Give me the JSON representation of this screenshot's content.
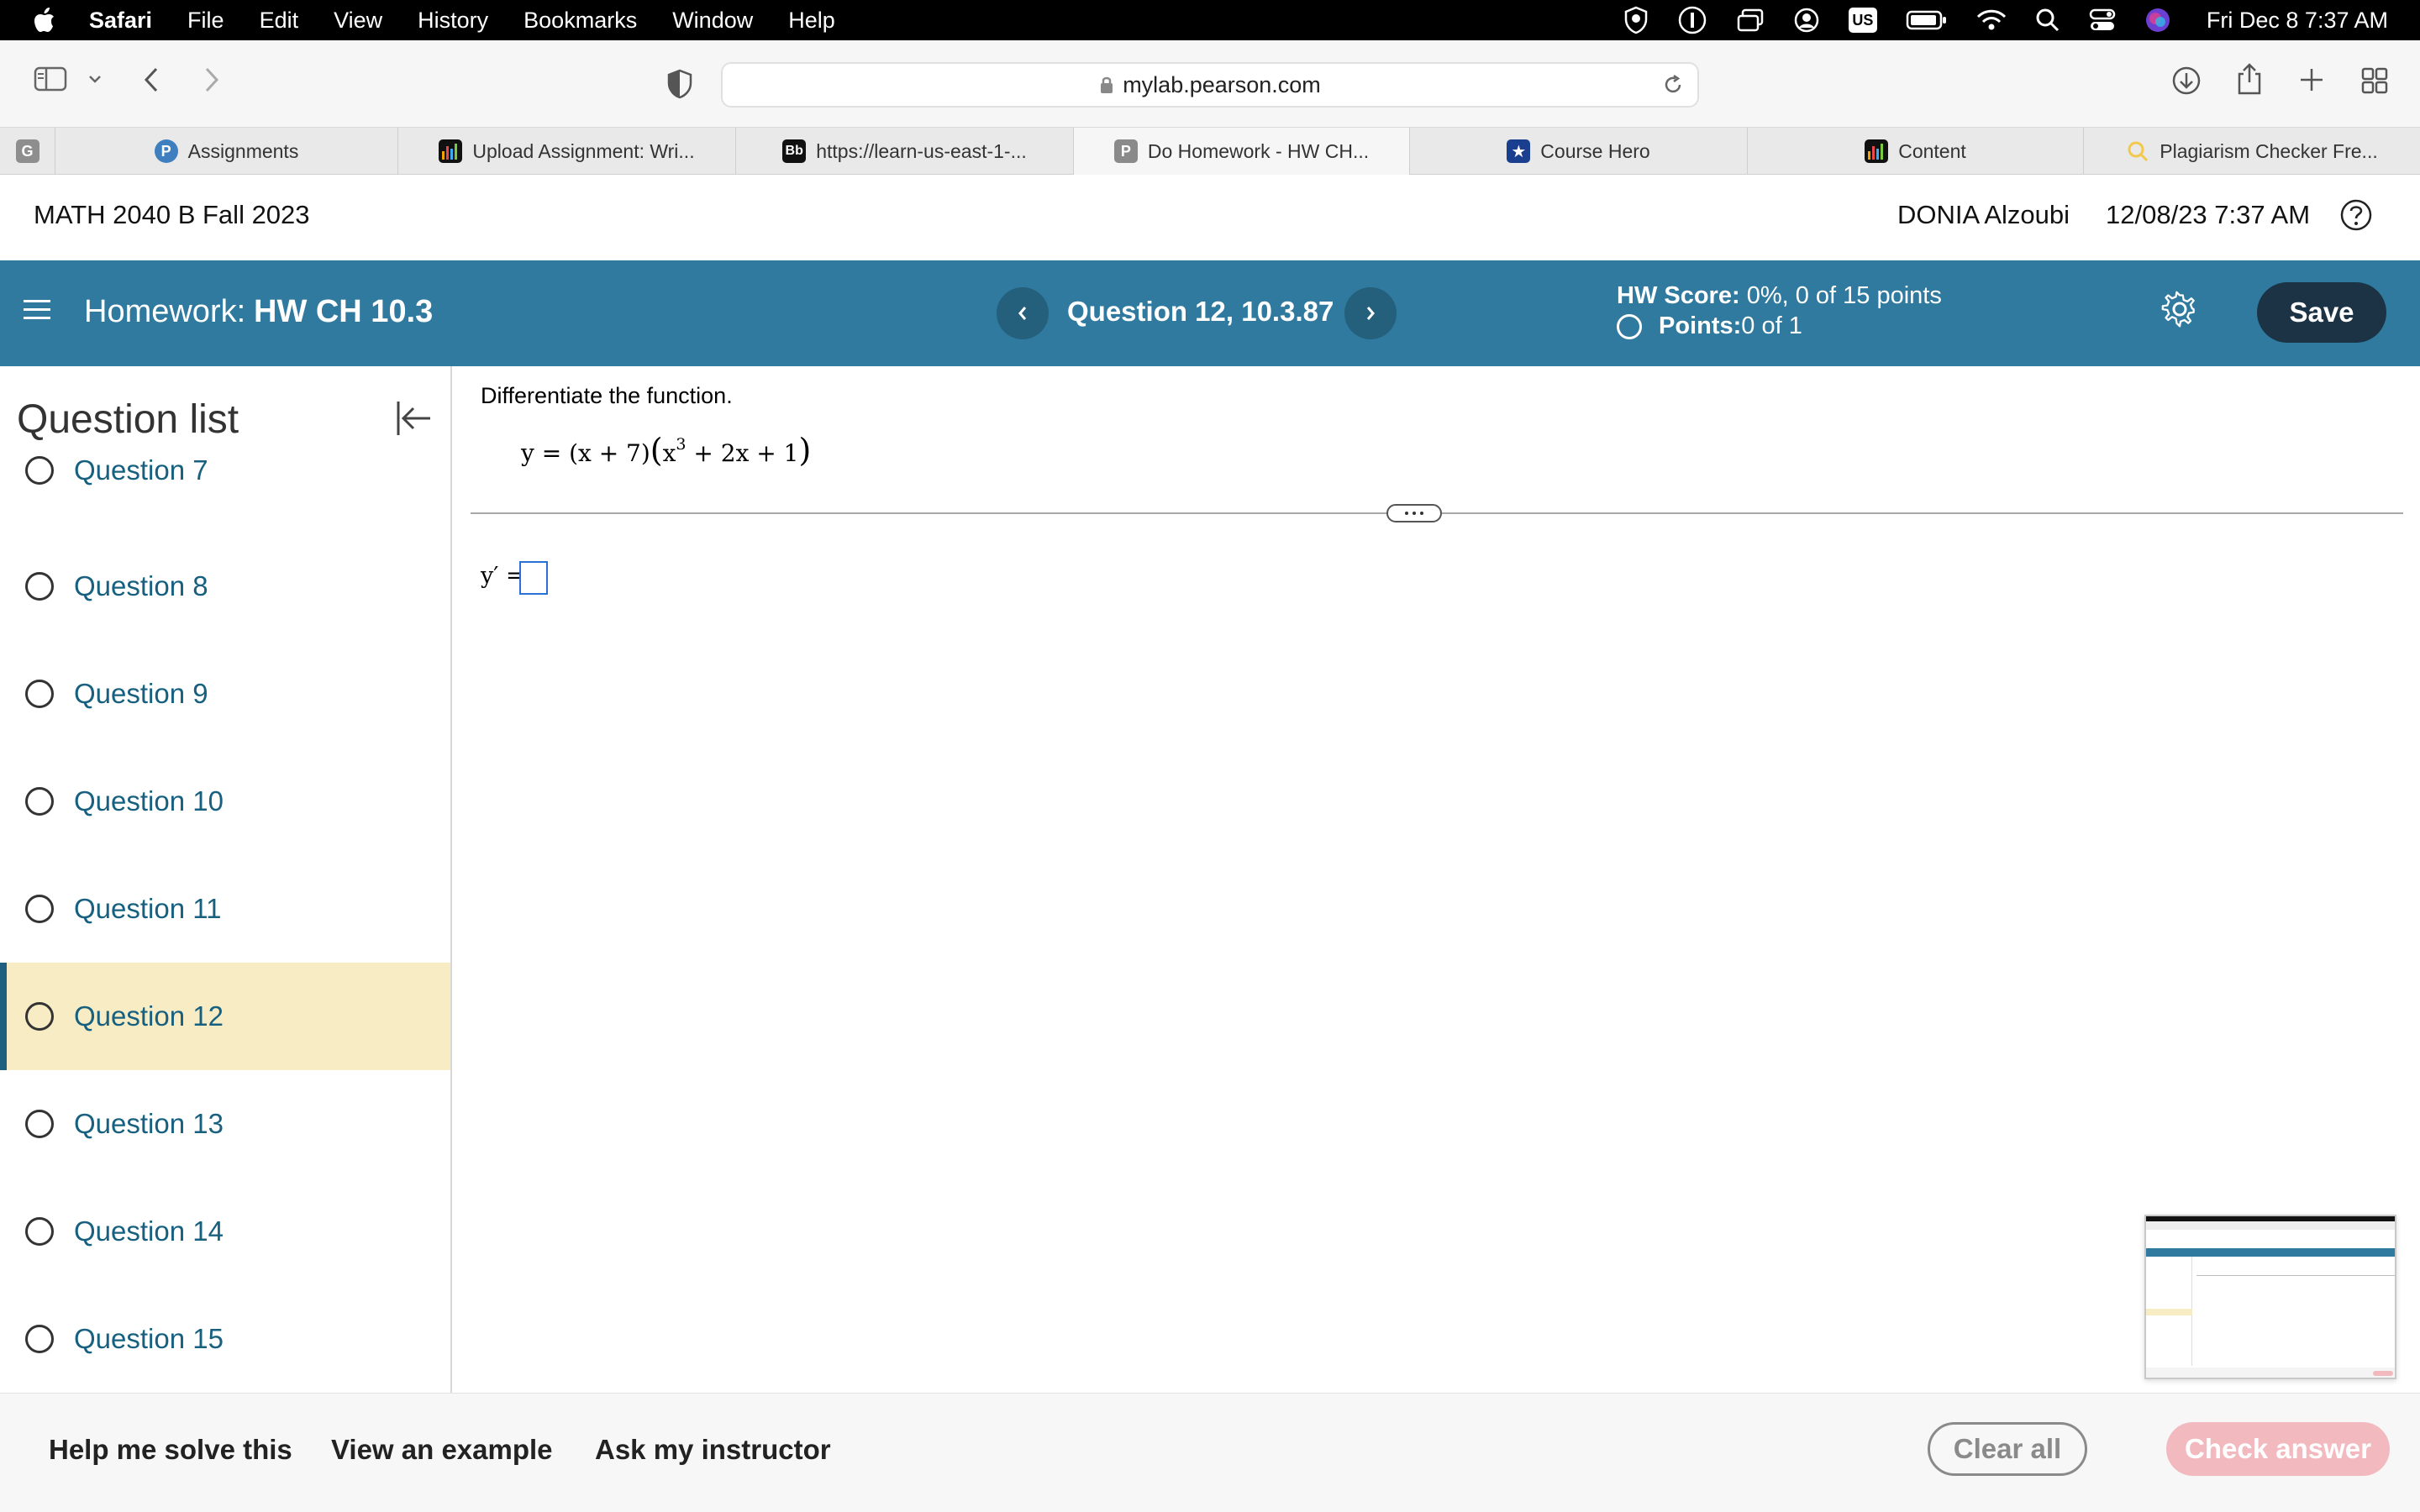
{
  "menubar": {
    "app": "Safari",
    "items": [
      "File",
      "Edit",
      "View",
      "History",
      "Bookmarks",
      "Window",
      "Help"
    ],
    "clock": "Fri Dec 8  7:37 AM",
    "input_source": "US"
  },
  "browser": {
    "url": "mylab.pearson.com",
    "tabs": [
      {
        "label": "",
        "fav_text": "G",
        "fav_color": "#8e8e8e"
      },
      {
        "label": "Assignments",
        "fav_text": "P",
        "fav_color": "#3f7fbf"
      },
      {
        "label": "Upload Assignment: Wri...",
        "fav_text": "",
        "fav_color": "#f0a500"
      },
      {
        "label": "https://learn-us-east-1-...",
        "fav_text": "Bb",
        "fav_color": "#111111"
      },
      {
        "label": "Do Homework - HW CH...",
        "fav_text": "P",
        "fav_color": "#8a8a8a"
      },
      {
        "label": "Course Hero",
        "fav_text": "★",
        "fav_color": "#1a3f8f"
      },
      {
        "label": "Content",
        "fav_text": "",
        "fav_color": "#f0a500"
      },
      {
        "label": "Plagiarism Checker Fre...",
        "fav_text": "",
        "fav_color": "#f2c94c"
      }
    ]
  },
  "course": {
    "title": "MATH 2040 B Fall 2023",
    "user": "DONIA Alzoubi",
    "datetime": "12/08/23 7:37 AM"
  },
  "homework": {
    "label": "Homework:",
    "name": "HW CH 10.3",
    "question_title": "Question 12, 10.3.87",
    "score_label": "HW Score:",
    "score_value": " 0%, 0 of 15 points",
    "points_label": "Points:",
    "points_value": " 0 of 1",
    "save_label": "Save"
  },
  "sidebar": {
    "title": "Question list",
    "items": [
      {
        "label": "Question 7",
        "current": false
      },
      {
        "label": "Question 8",
        "current": false
      },
      {
        "label": "Question 9",
        "current": false
      },
      {
        "label": "Question 10",
        "current": false
      },
      {
        "label": "Question 11",
        "current": false
      },
      {
        "label": "Question 12",
        "current": true
      },
      {
        "label": "Question 13",
        "current": false
      },
      {
        "label": "Question 14",
        "current": false
      },
      {
        "label": "Question 15",
        "current": false
      }
    ]
  },
  "question": {
    "instruction": "Differentiate the function.",
    "equation": {
      "lhs": "y = (x + 7)",
      "open_paren": "(",
      "base": "x",
      "exponent": "3",
      "rest": " + 2x + 1",
      "close_paren": ")"
    },
    "answer_label": "y′ ="
  },
  "footer": {
    "help_label": "Help me solve this",
    "example_label": "View an example",
    "instructor_label": "Ask my instructor",
    "clear_label": "Clear all",
    "check_label": "Check answer"
  },
  "colors": {
    "header_bar": "#2f7a9e",
    "save_button": "#1b3345",
    "current_question_bg": "#f8ecc4",
    "link_text": "#17607f",
    "check_button_disabled": "#f2b9bf"
  }
}
